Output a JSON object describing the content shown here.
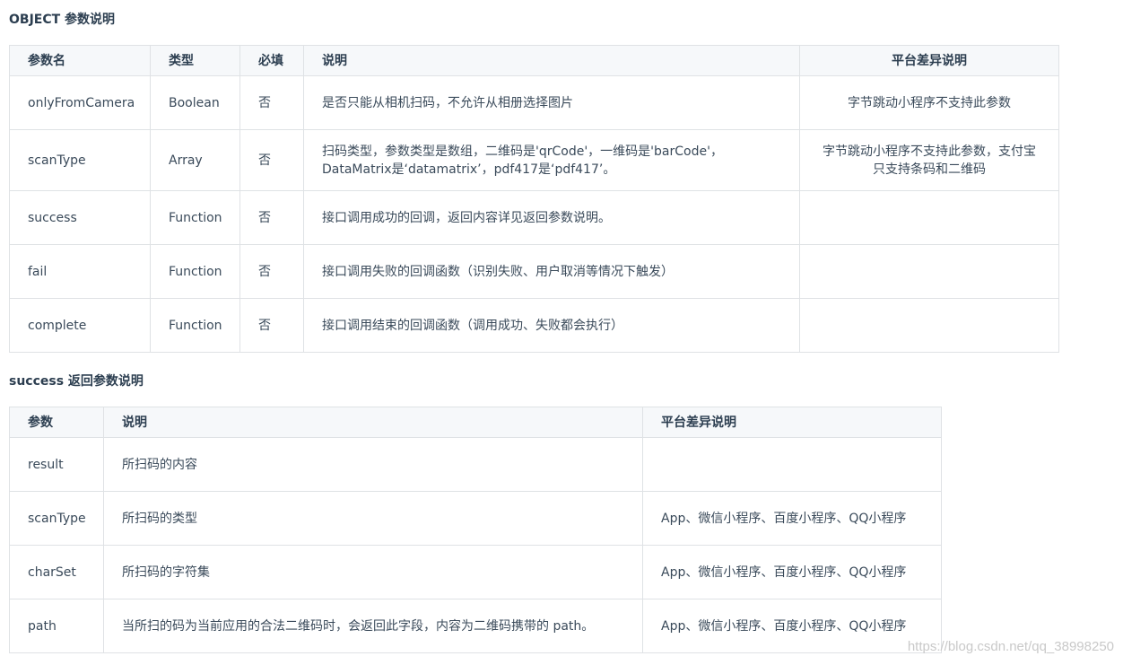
{
  "section1": {
    "title": "OBJECT 参数说明",
    "headers": [
      "参数名",
      "类型",
      "必填",
      "说明",
      "平台差异说明"
    ],
    "rows": [
      [
        "onlyFromCamera",
        "Boolean",
        "否",
        "是否只能从相机扫码，不允许从相册选择图片",
        "字节跳动小程序不支持此参数"
      ],
      [
        "scanType",
        "Array",
        "否",
        "扫码类型，参数类型是数组，二维码是'qrCode'，一维码是'barCode'，DataMatrix是‘datamatrix’，pdf417是‘pdf417’。",
        "字节跳动小程序不支持此参数，支付宝只支持条码和二维码"
      ],
      [
        "success",
        "Function",
        "否",
        "接口调用成功的回调，返回内容详见返回参数说明。",
        ""
      ],
      [
        "fail",
        "Function",
        "否",
        "接口调用失败的回调函数（识别失败、用户取消等情况下触发）",
        ""
      ],
      [
        "complete",
        "Function",
        "否",
        "接口调用结束的回调函数（调用成功、失败都会执行）",
        ""
      ]
    ]
  },
  "section2": {
    "title": "success 返回参数说明",
    "headers": [
      "参数",
      "说明",
      "平台差异说明"
    ],
    "rows": [
      [
        "result",
        "所扫码的内容",
        ""
      ],
      [
        "scanType",
        "所扫码的类型",
        "App、微信小程序、百度小程序、QQ小程序"
      ],
      [
        "charSet",
        "所扫码的字符集",
        "App、微信小程序、百度小程序、QQ小程序"
      ],
      [
        "path",
        "当所扫的码为当前应用的合法二维码时，会返回此字段，内容为二维码携带的 path。",
        "App、微信小程序、百度小程序、QQ小程序"
      ]
    ]
  },
  "watermark": "https://blog.csdn.net/qq_38998250"
}
